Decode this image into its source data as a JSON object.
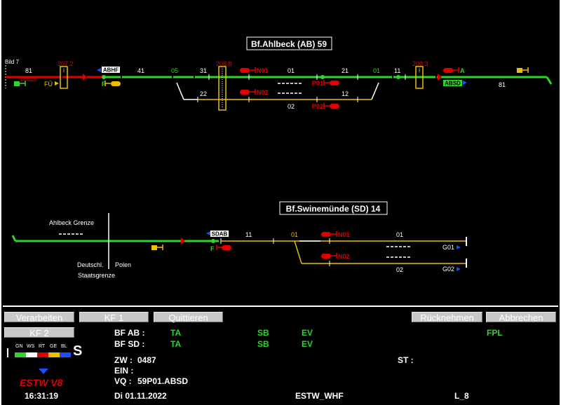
{
  "colors": {
    "occupied": "#e00000",
    "set_route": "#2fd52f",
    "free": "#e8c000",
    "plain": "#ffffff",
    "blue": "#1e4cff",
    "button_bg": "#c8c8c8"
  },
  "station_ab": {
    "title": "Bf.Ahlbeck (AB) 59",
    "labels": {
      "bild7": "Bild 7",
      "t81_left": "81",
      "km": "18825",
      "sig207_2": "207.2",
      "fue": "FÜ",
      "abhf": "ABHF",
      "f": "F",
      "t41": "41",
      "t05": "05",
      "t31": "31",
      "sig208_8": "208.8",
      "n01": "N01",
      "t01": "01",
      "t21": "21",
      "t01b": "01",
      "t11": "11",
      "sig208_3": "208.3",
      "a": "A",
      "absd": "ABSD",
      "t81_right": "81",
      "t22": "22",
      "n02": "N02",
      "p01": "P01",
      "t12": "12",
      "t02": "02",
      "p02": "P02"
    }
  },
  "station_sd": {
    "title": "Bf.Swinemünde (SD) 14",
    "labels": {
      "border_top": "Ahlbeck  Grenze",
      "deutschl": "Deutschl.",
      "polen": "Polen",
      "staatsgrenze": "Staatsgrenze",
      "sdab": "SDAB",
      "f": "F",
      "t11": "11",
      "t01y": "01",
      "n01": "N01",
      "t01": "01",
      "g01": "G01",
      "n02": "N02",
      "t02": "02",
      "g02": "G02"
    }
  },
  "buttons": {
    "verarbeiten": "Verarbeiten",
    "kf1": "KF 1",
    "quittieren": "Quittieren",
    "ruecknehmen": "Rücknehmen",
    "abbrechen": "Abbrechen",
    "kf2": "KF 2"
  },
  "legend": {
    "labels": [
      "GN",
      "WS",
      "RT",
      "GE",
      "BL"
    ],
    "colors": [
      "#2fd52f",
      "#ffffff",
      "#e00000",
      "#e8c000",
      "#1e4cff"
    ],
    "s_letter": "S"
  },
  "status": {
    "bf_ab_label": "BF AB :",
    "bf_sd_label": "BF SD :",
    "ab_ta": "TA",
    "ab_sb": "SB",
    "ab_ev": "EV",
    "ab_fpl": "FPL",
    "sd_ta": "TA",
    "sd_sb": "SB",
    "sd_ev": "EV",
    "zw_label": "ZW :",
    "zw_value": "0487",
    "st_label": "ST :",
    "ein_label": "EIN :",
    "vq_label": "VQ :",
    "vq_value": "59P01.ABSD"
  },
  "footer": {
    "brand": "ESTW V8",
    "time": "16:31:19",
    "date": "Di  01.11.2022",
    "system": "ESTW_WHF",
    "level": "L_8"
  }
}
